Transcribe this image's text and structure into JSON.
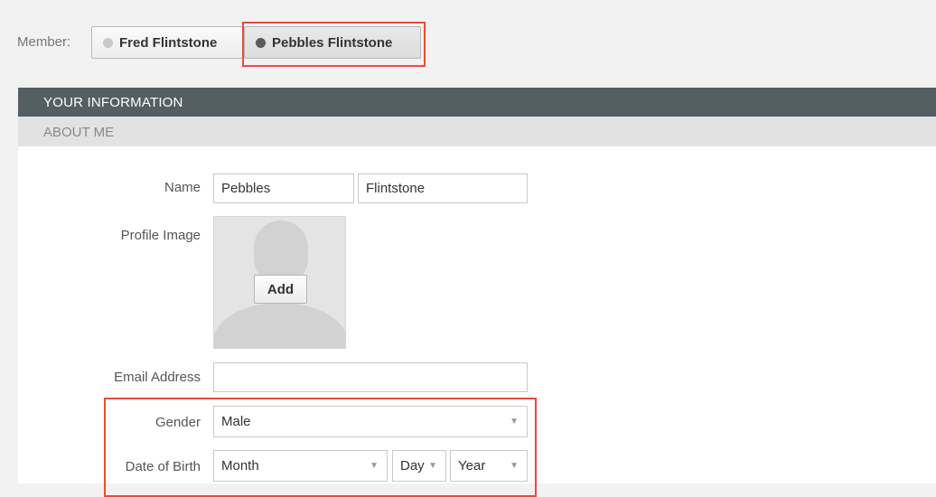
{
  "member": {
    "label": "Member:",
    "options": [
      "Fred Flintstone",
      "Pebbles Flintstone"
    ],
    "selected": "Pebbles Flintstone"
  },
  "section": {
    "title": "YOUR INFORMATION",
    "subtitle": "ABOUT ME"
  },
  "form": {
    "name_label": "Name",
    "first_name": "Pebbles",
    "last_name": "Flintstone",
    "profile_label": "Profile Image",
    "add_label": "Add",
    "email_label": "Email Address",
    "email_value": "",
    "gender_label": "Gender",
    "gender_value": "Male",
    "dob_label": "Date of Birth",
    "month_value": "Month",
    "day_value": "Day",
    "year_value": "Year"
  },
  "icons": {
    "dropdown": "chevron-down-icon",
    "selector": "radio-dot-icon",
    "avatar": "avatar-silhouette-icon"
  },
  "colors": {
    "header_bg": "#545f63",
    "subheader_bg": "#e2e2e2",
    "highlight": "#e74c3c"
  }
}
